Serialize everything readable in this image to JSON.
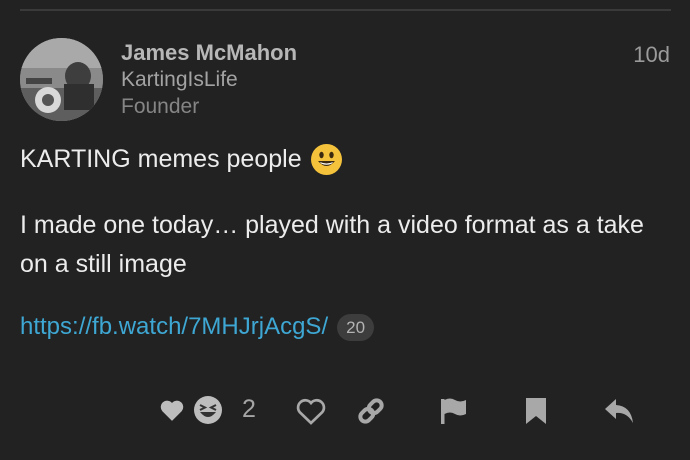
{
  "post": {
    "username": "James McMahon",
    "full_name": "KartingIsLife",
    "user_title": "Founder",
    "date": "10d",
    "line1": "KARTING memes people",
    "line1_emoji": "smiley-emoji",
    "line2": "I made one today… played with a video format as a take on a still image",
    "link_text": "https://fb.watch/7MHJrjAcgS/",
    "link_clicks": "20"
  },
  "actions": {
    "reaction_count": "2",
    "icons": [
      "heart-reaction-icon",
      "laughing-reaction-icon",
      "like-icon",
      "copy-link-icon",
      "flag-icon",
      "bookmark-icon",
      "reply-icon"
    ]
  },
  "colors": {
    "background": "#222222",
    "link": "#3ea7d3",
    "text": "#ececec",
    "muted": "#a3a3a3"
  }
}
